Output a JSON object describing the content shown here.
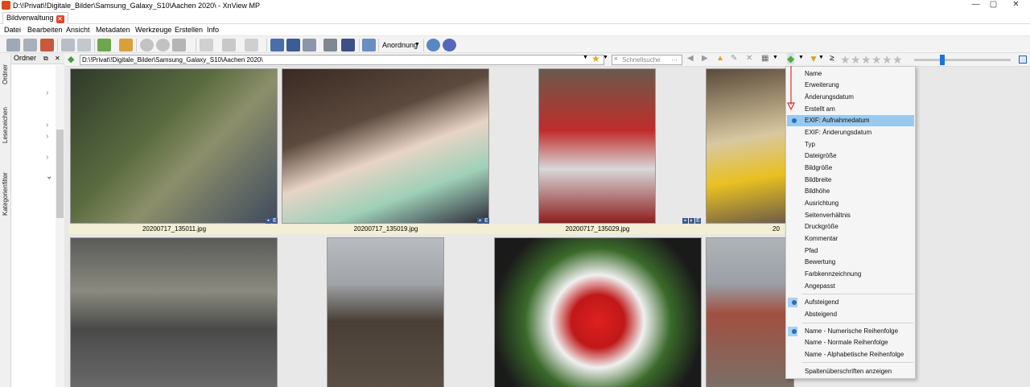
{
  "window": {
    "title": "D:\\!Privat\\!Digitale_Bilder\\Samsung_Galaxy_S10\\Aachen 2020\\ - XnView MP",
    "minimize": "—",
    "maximize": "▢",
    "close": "✕"
  },
  "tab": {
    "label": "Bildverwaltung",
    "close_glyph": "✕"
  },
  "menu": [
    "Datei",
    "Bearbeiten",
    "Ansicht",
    "Metadaten",
    "Werkzeuge",
    "Erstellen",
    "Info"
  ],
  "toolbar": {
    "arrange_label": "Anordnung"
  },
  "side_tabs": [
    "Ordner",
    "Lesezeichen",
    "Kategorienfilter"
  ],
  "folder_panel": {
    "title": "Ordner"
  },
  "path": {
    "value": "D:\\!Privat\\!Digitale_Bilder\\Samsung_Galaxy_S10\\Aachen 2020\\",
    "search_placeholder": "Schnellsuche",
    "rating_operator": "≥"
  },
  "thumbnails": [
    {
      "caption": "20200717_135011.jpg",
      "selected": true
    },
    {
      "caption": "20200717_135019.jpg",
      "selected": true
    },
    {
      "caption": "20200717_135029.jpg",
      "selected": true
    },
    {
      "caption": "20",
      "selected": true
    },
    {
      "caption": "",
      "selected": false
    },
    {
      "caption": "",
      "selected": false
    },
    {
      "caption": "",
      "selected": false
    },
    {
      "caption": "",
      "selected": false
    }
  ],
  "sort_menu": {
    "items": [
      {
        "label": "Name"
      },
      {
        "label": "Erweiterung"
      },
      {
        "label": "Änderungsdatum"
      },
      {
        "label": "Erstellt am"
      },
      {
        "label": "EXIF: Aufnahmedatum",
        "checked": true,
        "highlighted": true
      },
      {
        "label": "EXIF: Änderungsdatum"
      },
      {
        "label": "Typ"
      },
      {
        "label": "Dateigröße"
      },
      {
        "label": "Bildgröße"
      },
      {
        "label": "Bildbreite"
      },
      {
        "label": "Bildhöhe"
      },
      {
        "label": "Ausrichtung"
      },
      {
        "label": "Seitenverhältnis"
      },
      {
        "label": "Druckgröße"
      },
      {
        "label": "Kommentar"
      },
      {
        "label": "Pfad"
      },
      {
        "label": "Bewertung"
      },
      {
        "label": "Farbkennzeichnung"
      },
      {
        "label": "Angepasst"
      }
    ],
    "order": [
      {
        "label": "Aufsteigend",
        "checked": true
      },
      {
        "label": "Absteigend"
      }
    ],
    "collation": [
      {
        "label": "Name - Numerische Reihenfolge",
        "checked": true
      },
      {
        "label": "Name - Normale Reihenfolge"
      },
      {
        "label": "Name - Alphabetische Reihenfolge"
      }
    ],
    "footer": {
      "label": "Spaltenüberschriften anzeigen"
    }
  },
  "colors": {
    "accent": "#99c9ef",
    "selection_caption": "#f2efd4",
    "annotation_arrow": "#e0302a"
  }
}
